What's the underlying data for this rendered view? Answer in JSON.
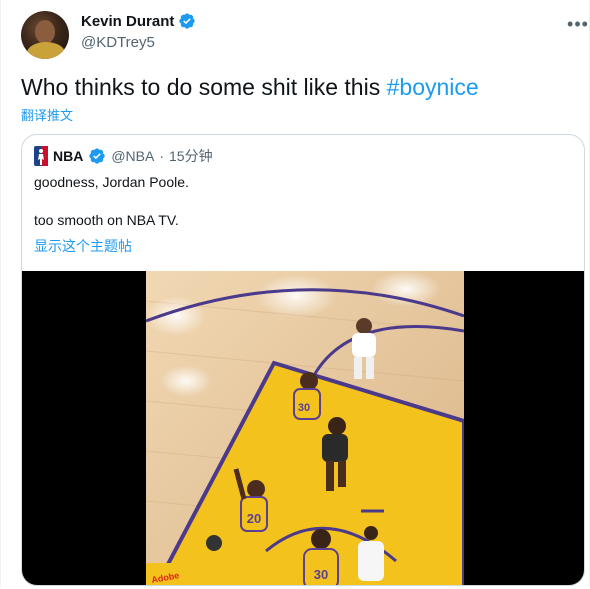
{
  "tweet": {
    "display_name": "Kevin Durant",
    "handle": "@KDTrey5",
    "text_main": "Who thinks to do some shit like this ",
    "hashtag": "#boynice",
    "translate_label": "翻译推文",
    "more_icon": "more-icon"
  },
  "quote": {
    "name": "NBA",
    "handle": "@NBA",
    "separator": " · ",
    "time": "15分钟",
    "line1": "goodness, Jordan Poole.",
    "line2": "too smooth on NBA TV.",
    "show_thread": "显示这个主题帖"
  },
  "court_marks": {
    "jersey_a": "30",
    "jersey_b": "20",
    "jersey_c": "30",
    "sponsor": "Adobe"
  },
  "colors": {
    "link": "#1d9bf0",
    "verified": "#1d9bf0",
    "court_wood": "#e8c9a0",
    "paint": "#f4c21d",
    "lines": "#4b3a8c"
  }
}
